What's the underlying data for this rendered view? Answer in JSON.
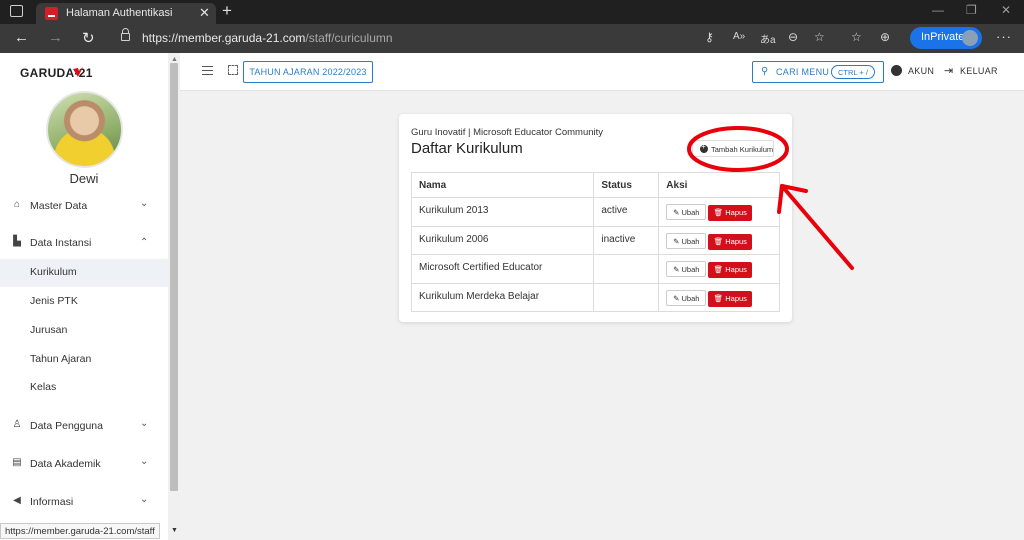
{
  "browser": {
    "tab_title": "Halaman Authentikasi",
    "url_host": "https://member.garuda-21.com",
    "url_path": "/staff/curiculumn",
    "inprivate_label": "InPrivate",
    "status_url": "https://member.garuda-21.com/staff"
  },
  "brand": {
    "logo_text": "GARUDA-21",
    "accent": "#d40f1c",
    "primary": "#2a7cc7"
  },
  "user": {
    "name": "Dewi"
  },
  "sidebar": {
    "items": [
      {
        "label": "Master Data",
        "icon": "home-icon"
      },
      {
        "label": "Data Instansi",
        "icon": "building-icon"
      },
      {
        "label": "Kurikulum",
        "sub": true,
        "active": true
      },
      {
        "label": "Jenis PTK",
        "sub": true
      },
      {
        "label": "Jurusan",
        "sub": true
      },
      {
        "label": "Tahun Ajaran",
        "sub": true
      },
      {
        "label": "Kelas",
        "sub": true
      },
      {
        "label": "Data Pengguna",
        "icon": "user-icon"
      },
      {
        "label": "Data Akademik",
        "icon": "book-icon"
      },
      {
        "label": "Informasi",
        "icon": "megaphone-icon"
      }
    ]
  },
  "topbar": {
    "year_label": "TAHUN AJARAN 2022/2023",
    "search_label": "CARI MENU",
    "search_shortcut": "CTRL + /",
    "account_label": "AKUN",
    "logout_label": "KELUAR"
  },
  "card": {
    "subtitle": "Guru Inovatif | Microsoft Educator Community",
    "title": "Daftar Kurikulum",
    "add_label": "Tambah Kurikulum",
    "columns": [
      "Nama",
      "Status",
      "Aksi"
    ],
    "rows": [
      {
        "name": "Kurikulum 2013",
        "status": "active"
      },
      {
        "name": "Kurikulum 2006",
        "status": "inactive"
      },
      {
        "name": "Microsoft Certified Educator",
        "status": ""
      },
      {
        "name": "Kurikulum Merdeka Belajar",
        "status": ""
      }
    ],
    "edit_label": "Ubah",
    "delete_label": "Hapus"
  }
}
